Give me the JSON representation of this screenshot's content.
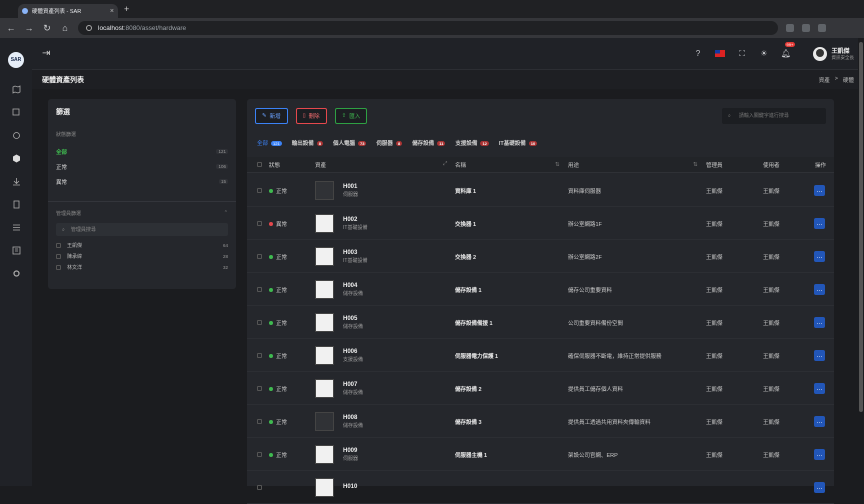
{
  "browser": {
    "tab_title": "硬體資產列表 - SAR",
    "url_host": "localhost",
    "url_path": ":8080/asset/hardware"
  },
  "app": {
    "logo": "SAR",
    "notif_count": "99+"
  },
  "user": {
    "name": "王凱傑",
    "role": "資訊安全長"
  },
  "page": {
    "title": "硬體資產列表",
    "crumb_root": "資產",
    "crumb_sep": ">",
    "crumb_current": "硬體"
  },
  "filters": {
    "title": "篩選",
    "status_section": "狀態篩選",
    "status": [
      {
        "label": "全部",
        "count": "121"
      },
      {
        "label": "正常",
        "count": "106"
      },
      {
        "label": "異常",
        "count": "15"
      }
    ],
    "manager_section": "管理員篩選",
    "manager_placeholder": "管理員搜尋",
    "managers": [
      {
        "name": "王凱傑",
        "count": "64"
      },
      {
        "name": "陳承緯",
        "count": "28"
      },
      {
        "name": "林文洋",
        "count": "32"
      }
    ]
  },
  "toolbar": {
    "add": "新增",
    "delete": "刪除",
    "import": "匯入",
    "search_placeholder": "請輸入關鍵字進行搜尋"
  },
  "tabs": [
    {
      "label": "全部",
      "count": "121"
    },
    {
      "label": "輸出設備",
      "count": "8"
    },
    {
      "label": "個人電腦",
      "count": "73"
    },
    {
      "label": "伺服器",
      "count": "8"
    },
    {
      "label": "儲存設備",
      "count": "11"
    },
    {
      "label": "支援設備",
      "count": "12"
    },
    {
      "label": "IT基礎設備",
      "count": "10"
    }
  ],
  "columns": {
    "status": "狀態",
    "asset": "資產",
    "name": "名稱",
    "purpose": "用途",
    "manager": "管理員",
    "user": "使用者",
    "action": "操作"
  },
  "rows": [
    {
      "status": "正常",
      "ok": true,
      "id": "H001",
      "type": "伺服器",
      "name": "資料庫 1",
      "purpose": "資料庫伺服器",
      "manager": "王凱傑",
      "user": "王凱傑"
    },
    {
      "status": "異常",
      "ok": false,
      "id": "H002",
      "type": "IT基礎設備",
      "name": "交換器 1",
      "purpose": "辦公室網路1F",
      "manager": "王凱傑",
      "user": "王凱傑"
    },
    {
      "status": "正常",
      "ok": true,
      "id": "H003",
      "type": "IT基礎設備",
      "name": "交換器 2",
      "purpose": "辦公室網路2F",
      "manager": "王凱傑",
      "user": "王凱傑"
    },
    {
      "status": "正常",
      "ok": true,
      "id": "H004",
      "type": "儲存設備",
      "name": "儲存設備 1",
      "purpose": "儲存公司重要資料",
      "manager": "王凱傑",
      "user": "王凱傑"
    },
    {
      "status": "正常",
      "ok": true,
      "id": "H005",
      "type": "儲存設備",
      "name": "儲存設備備援 1",
      "purpose": "公司重要資料備份空間",
      "manager": "王凱傑",
      "user": "王凱傑"
    },
    {
      "status": "正常",
      "ok": true,
      "id": "H006",
      "type": "支援設備",
      "name": "伺服器電力保護 1",
      "purpose": "確保伺服器不斷電，維持正常提供服務",
      "manager": "王凱傑",
      "user": "王凱傑"
    },
    {
      "status": "正常",
      "ok": true,
      "id": "H007",
      "type": "儲存設備",
      "name": "儲存設備 2",
      "purpose": "提供員工儲存個人資料",
      "manager": "王凱傑",
      "user": "王凱傑"
    },
    {
      "status": "正常",
      "ok": true,
      "id": "H008",
      "type": "儲存設備",
      "name": "儲存設備 3",
      "purpose": "提供員工透過共用資料夾傳輸資料",
      "manager": "王凱傑",
      "user": "王凱傑"
    },
    {
      "status": "正常",
      "ok": true,
      "id": "H009",
      "type": "伺服器",
      "name": "伺服器主機 1",
      "purpose": "架設公司官網、ERP",
      "manager": "王凱傑",
      "user": "王凱傑"
    },
    {
      "status": "",
      "ok": true,
      "id": "H010",
      "type": "",
      "name": "",
      "purpose": "",
      "manager": "",
      "user": ""
    }
  ],
  "colors": {
    "ok": "#3fb950",
    "bad": "#e5484d",
    "accent": "#3b82f6"
  }
}
